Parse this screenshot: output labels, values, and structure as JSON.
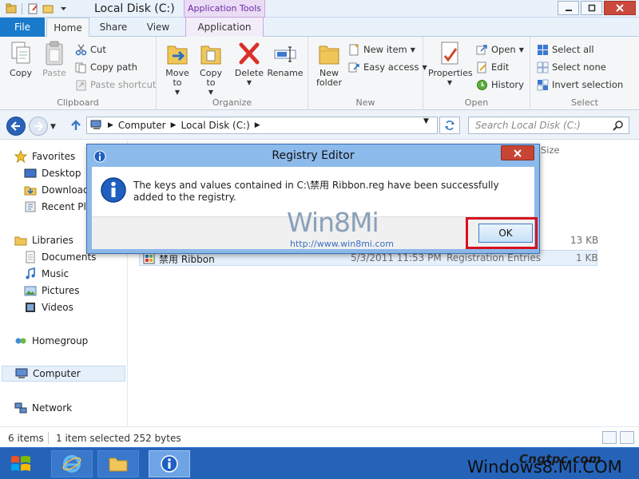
{
  "window": {
    "title": "Local Disk (C:)",
    "contextual_tab": "Application Tools"
  },
  "tabs": {
    "file": "File",
    "home": "Home",
    "share": "Share",
    "view": "View",
    "application": "Application"
  },
  "ribbon": {
    "clipboard": {
      "label": "Clipboard",
      "copy": "Copy",
      "paste": "Paste",
      "cut": "Cut",
      "copy_path": "Copy path",
      "paste_shortcut": "Paste shortcut"
    },
    "organize": {
      "label": "Organize",
      "move_to": "Move to",
      "copy_to": "Copy to",
      "delete": "Delete",
      "rename": "Rename"
    },
    "new": {
      "label": "New",
      "new_folder": "New folder",
      "new_item": "New item",
      "easy_access": "Easy access"
    },
    "open": {
      "label": "Open",
      "properties": "Properties",
      "open": "Open",
      "edit": "Edit",
      "history": "History"
    },
    "select": {
      "label": "Select",
      "select_all": "Select all",
      "select_none": "Select none",
      "invert_selection": "Invert selection"
    }
  },
  "address": {
    "segments": [
      "Computer",
      "Local Disk (C:)"
    ],
    "search_placeholder": "Search Local Disk (C:)"
  },
  "nav_pane": {
    "favorites": "Favorites",
    "desktop": "Desktop",
    "downloads": "Downloads",
    "recent_places": "Recent Plac",
    "libraries": "Libraries",
    "documents": "Documents",
    "music": "Music",
    "pictures": "Pictures",
    "videos": "Videos",
    "homegroup": "Homegroup",
    "computer": "Computer",
    "network": "Network"
  },
  "file_list": {
    "col_size": "Size",
    "rows": [
      {
        "name": "",
        "date": "",
        "type": "",
        "size": "13 KB"
      },
      {
        "name": "禁用 Ribbon",
        "date": "5/3/2011 11:53 PM",
        "type": "Registration Entries",
        "size": "1 KB"
      }
    ]
  },
  "status": {
    "items": "6 items",
    "selected": "1 item selected  252 bytes"
  },
  "dialog": {
    "title": "Registry Editor",
    "message": "The keys and values contained in C:\\禁用 Ribbon.reg have been successfully added to the registry.",
    "watermark": "Win8Mi",
    "watermark_url": "http://www.win8mi.com",
    "ok": "OK"
  },
  "taskbar": {
    "watermark_text": "Windows8.Mi.COM",
    "watermark_logo": "Cngtpc.com"
  },
  "icons": {
    "accent": "#1979ca",
    "dialog_title_bg": "#8cbaea",
    "highlight": "#d6121f"
  }
}
